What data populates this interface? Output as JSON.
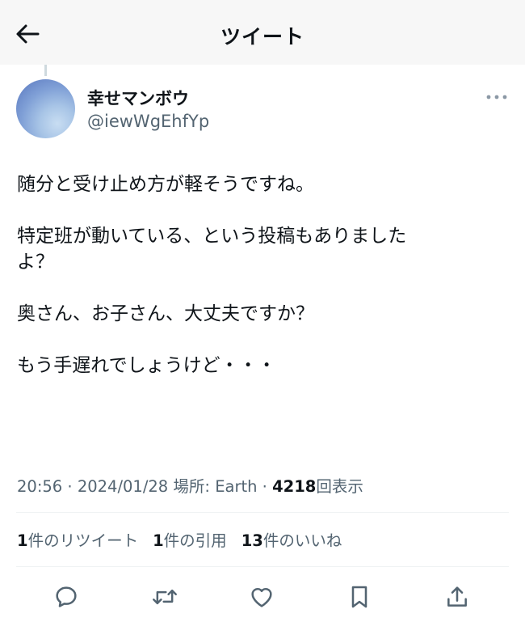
{
  "header": {
    "title": "ツイート"
  },
  "author": {
    "display_name": "幸せマンボウ",
    "handle": "@iewWgEhfYp"
  },
  "tweet": {
    "paragraphs": [
      "随分と受け止め方が軽そうですね。",
      "特定班が動いている、という投稿もありました\nよ？",
      "奥さん、お子さん、大丈夫ですか？",
      "もう手遅れでしょうけど・・・"
    ]
  },
  "meta": {
    "time": "20:56",
    "sep1": " · ",
    "date": "2024/01/28",
    "location_label": " 場所: ",
    "location": "Earth",
    "sep2": " · ",
    "views_count": "4218",
    "views_label": "回表示"
  },
  "stats": {
    "retweets_count": "1",
    "retweets_label": "件のリツイート",
    "quotes_count": "1",
    "quotes_label": "件の引用",
    "likes_count": "13",
    "likes_label": "件のいいね"
  },
  "icons": {
    "back": "arrow-left-icon",
    "more": "more-horizontal-icon",
    "reply": "reply-icon",
    "retweet": "retweet-icon",
    "like": "heart-icon",
    "bookmark": "bookmark-icon",
    "share": "share-icon"
  },
  "colors": {
    "text": "#0f1419",
    "secondary": "#536471",
    "divider": "#eff3f4",
    "header_bg": "#f7f7f7"
  }
}
